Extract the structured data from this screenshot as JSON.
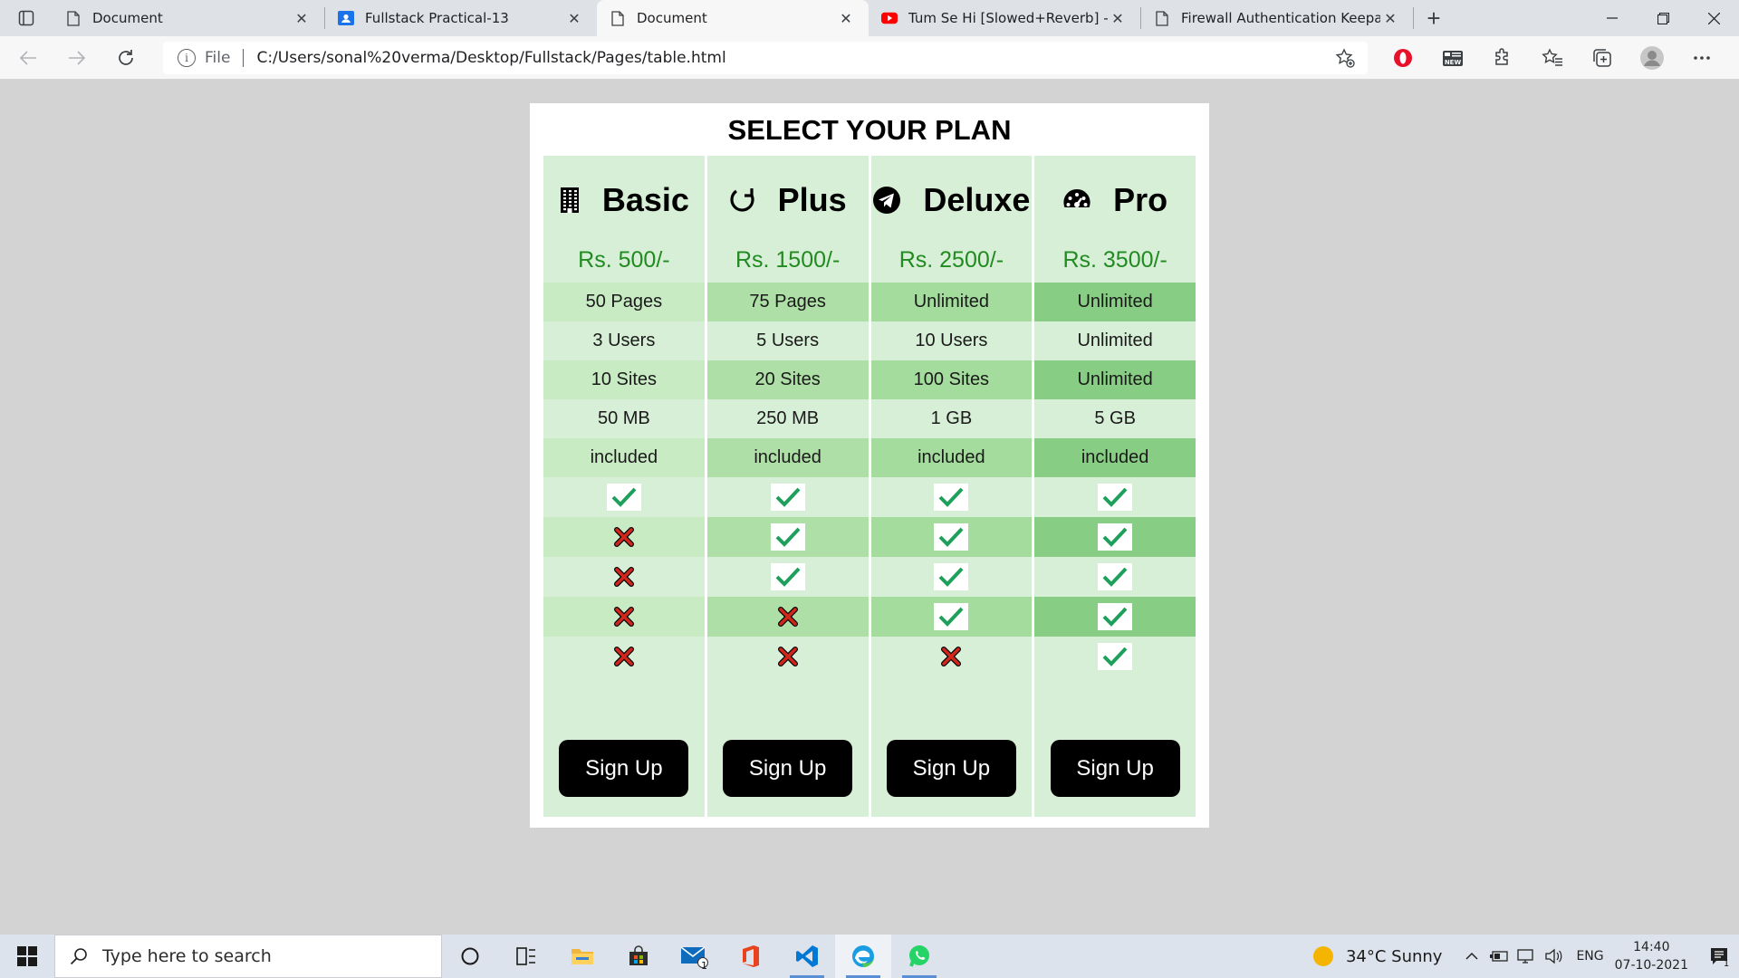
{
  "browser": {
    "tabs": [
      {
        "title": "Document",
        "icon": "document-icon",
        "active": false
      },
      {
        "title": "Fullstack Practical-13",
        "icon": "classroom-icon",
        "active": false
      },
      {
        "title": "Document",
        "icon": "document-icon",
        "active": true
      },
      {
        "title": "Tum Se Hi [Slowed+Reverb] - Jal",
        "icon": "youtube-icon",
        "active": false
      },
      {
        "title": "Firewall Authentication Keepalive",
        "icon": "document-icon",
        "active": false
      }
    ],
    "address": {
      "scheme_label": "File",
      "url": "C:/Users/sonal%20verma/Desktop/Fullstack/Pages/table.html"
    }
  },
  "page": {
    "title": "SELECT YOUR PLAN",
    "plans": [
      {
        "name": "Basic",
        "icon": "building-icon",
        "price": "Rs. 500/-",
        "features": [
          "50 Pages",
          "3 Users",
          "10 Sites",
          "50 MB",
          "included"
        ],
        "checks": [
          true,
          false,
          false,
          false,
          false
        ],
        "button": "Sign Up"
      },
      {
        "name": "Plus",
        "icon": "refresh-circle-icon",
        "price": "Rs. 1500/-",
        "features": [
          "75 Pages",
          "5 Users",
          "20 Sites",
          "250 MB",
          "included"
        ],
        "checks": [
          true,
          true,
          true,
          false,
          false
        ],
        "button": "Sign Up"
      },
      {
        "name": "Deluxe",
        "icon": "paper-plane-icon",
        "price": "Rs. 2500/-",
        "features": [
          "Unlimited",
          "10 Users",
          "100 Sites",
          "1 GB",
          "included"
        ],
        "checks": [
          true,
          true,
          true,
          true,
          false
        ],
        "button": "Sign Up"
      },
      {
        "name": "Pro",
        "icon": "dashboard-icon",
        "price": "Rs. 3500/-",
        "features": [
          "Unlimited",
          "Unlimited",
          "Unlimited",
          "5 GB",
          "included"
        ],
        "checks": [
          true,
          true,
          true,
          true,
          true
        ],
        "button": "Sign Up"
      }
    ],
    "colors": {
      "col_base": "#d7efd6",
      "stripe": [
        "#c8ebc4",
        "#addfa6",
        "#a3dc9c",
        "#88cd84"
      ],
      "price": "#218a21",
      "check": "#1e9f5b",
      "cross": "#d1261b"
    }
  },
  "taskbar": {
    "search_placeholder": "Type here to search",
    "weather": "34°C  Sunny",
    "lang": "ENG",
    "time": "14:40",
    "date": "07-10-2021",
    "mail_badge": "1",
    "notif_badge": "1"
  }
}
